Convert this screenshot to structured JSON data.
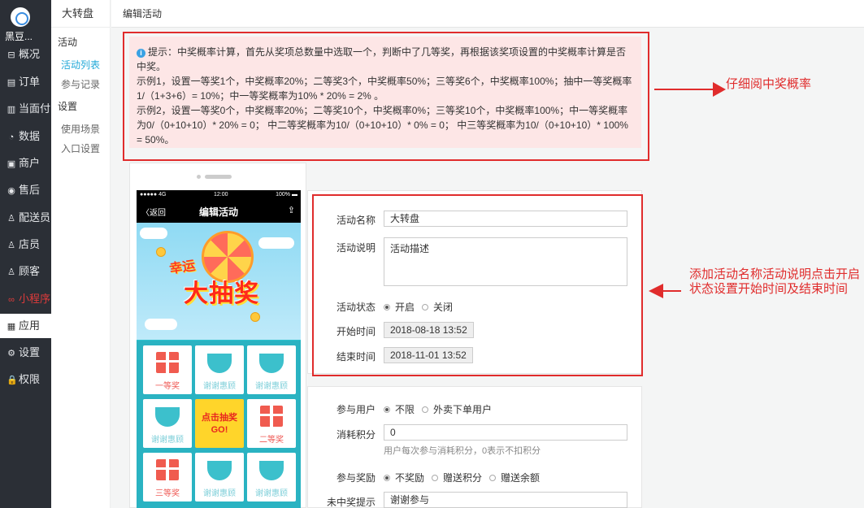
{
  "nav": {
    "brand": "黑豆...",
    "items": [
      {
        "label": "概况",
        "icon": "overview-icon",
        "glyph": "⊟"
      },
      {
        "label": "订单",
        "icon": "order-icon",
        "glyph": "▤"
      },
      {
        "label": "当面付",
        "icon": "pay-icon",
        "glyph": "▥"
      },
      {
        "label": "数据",
        "icon": "data-icon",
        "glyph": "◔"
      },
      {
        "label": "商户",
        "icon": "shop-icon",
        "glyph": "▣"
      },
      {
        "label": "售后",
        "icon": "aftersale-icon",
        "glyph": "◉"
      },
      {
        "label": "配送员",
        "icon": "courier-icon",
        "glyph": "♙"
      },
      {
        "label": "店员",
        "icon": "clerk-icon",
        "glyph": "♙"
      },
      {
        "label": "顾客",
        "icon": "customer-icon",
        "glyph": "♙"
      },
      {
        "label": "小程序",
        "icon": "miniapp-icon",
        "glyph": "∞"
      },
      {
        "label": "应用",
        "icon": "apps-icon",
        "glyph": "▦"
      },
      {
        "label": "设置",
        "icon": "settings-icon",
        "glyph": "⚙"
      },
      {
        "label": "权限",
        "icon": "lock-icon",
        "glyph": "🔒"
      }
    ]
  },
  "subnav": {
    "title": "大转盘",
    "group1": "活动",
    "link1": "活动列表",
    "link2": "参与记录",
    "group2": "设置",
    "link3": "使用场景",
    "link4": "入口设置"
  },
  "header": {
    "title": "编辑活动"
  },
  "tip": {
    "line1": "提示：中奖概率计算，首先从奖项总数量中选取一个，判断中了几等奖，再根据该奖项设置的中奖概率计算是否中奖。",
    "line2": "示例1，设置一等奖1个，中奖概率20%；二等奖3个，中奖概率50%；三等奖6个，中奖概率100%；抽中一等奖概率1/（1+3+6）= 10%；中一等奖概率为10% * 20% = 2% 。",
    "line3": "示例2，设置一等奖0个，中奖概率20%；二等奖10个，中奖概率0%；三等奖10个，中奖概率100%；中一等奖概率为0/（0+10+10）* 20% = 0； 中二等奖概率为10/（0+10+10）* 0% = 0； 中三等奖概率为10/（0+10+10）* 100% = 50%。"
  },
  "annotations": {
    "a1": "仔细阅中奖概率",
    "a2": "添加活动名称活动说明点击开启状态设置开始时间及结束时间"
  },
  "phone": {
    "status_left": "●●●●● 4G",
    "status_time": "12:00",
    "status_right": "100% ▬",
    "back": "〈返回",
    "title": "编辑活动",
    "lucky": "幸运",
    "big": "大抽奖",
    "cells": [
      "一等奖",
      "谢谢惠顾",
      "谢谢惠顾",
      "谢谢惠顾",
      "点击抽奖GO!",
      "二等奖",
      "三等奖",
      "谢谢惠顾",
      "谢谢惠顾"
    ]
  },
  "form": {
    "name_label": "活动名称",
    "name_value": "大转盘",
    "desc_label": "活动说明",
    "desc_value": "活动描述",
    "status_label": "活动状态",
    "status_on": "开启",
    "status_off": "关闭",
    "start_label": "开始时间",
    "start_value": "2018-08-18 13:52",
    "end_label": "结束时间",
    "end_value": "2018-11-01 13:52",
    "user_label": "参与用户",
    "user_opt1": "不限",
    "user_opt2": "外卖下单用户",
    "points_label": "消耗积分",
    "points_value": "0",
    "points_help": "用户每次参与消耗积分，0表示不扣积分",
    "reward_label": "参与奖励",
    "reward_opt1": "不奖励",
    "reward_opt2": "赠送积分",
    "reward_opt3": "赠送余额",
    "miss_label": "未中奖提示",
    "miss_value": "谢谢参与"
  },
  "colors": {
    "accent": "#22a9d8",
    "alert": "#e02c2c",
    "tip_bg": "#fde6e6",
    "nav_bg": "#2b2f36"
  }
}
